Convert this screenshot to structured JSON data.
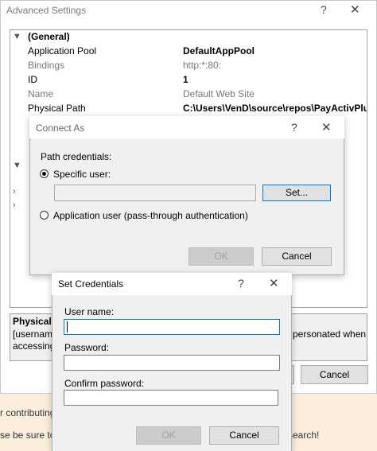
{
  "background": {
    "line1": "r contributing",
    "line2": "se be sure to",
    "line3": "search!"
  },
  "advanced": {
    "title": "Advanced Settings",
    "help": "?",
    "close": "✕",
    "rows": [
      {
        "exp": "▼",
        "key": "(General)",
        "value": "",
        "bold_key": true
      },
      {
        "key": "Application Pool",
        "value": "DefaultAppPool",
        "bold_value": true
      },
      {
        "key": "Bindings",
        "value": "http:*:80:",
        "dim": true
      },
      {
        "key": "ID",
        "value": "1",
        "bold_value": true
      },
      {
        "key": "Name",
        "value": "Default Web Site",
        "dim": true
      },
      {
        "key": "Physical Path",
        "value": "C:\\Users\\VenD\\source\\repos\\PayActivPlug\\Ei",
        "bold_value": true
      }
    ],
    "desc_title": "Physical P",
    "desc_line1": "[username",
    "desc_line1_right": "personated when",
    "desc_line2": "accessing",
    "cancel": "Cancel"
  },
  "connect_as": {
    "title": "Connect As",
    "help": "?",
    "close": "✕",
    "path_credentials": "Path credentials:",
    "specific_user": "Specific user:",
    "user_value": "",
    "set_button": "Set...",
    "app_user": "Application user (pass-through authentication)",
    "ok": "OK",
    "cancel": "Cancel"
  },
  "set_credentials": {
    "title": "Set Credentials",
    "help": "?",
    "close": "✕",
    "user_name_label": "User name:",
    "user_name_value": "",
    "password_label": "Password:",
    "password_value": "",
    "confirm_label": "Confirm password:",
    "confirm_value": "",
    "ok": "OK",
    "cancel": "Cancel"
  }
}
